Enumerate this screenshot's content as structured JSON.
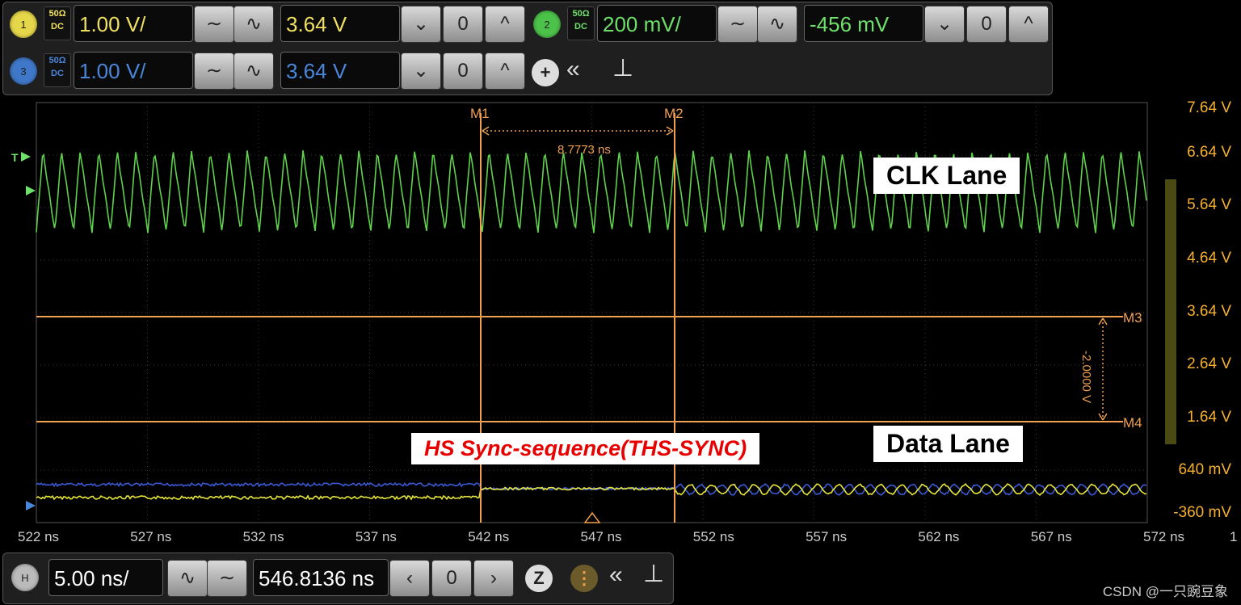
{
  "channels": [
    {
      "id": "1",
      "color": "#e6d64a",
      "impedance": "50Ω",
      "coupling": "DC",
      "scale": "1.00 V/",
      "offset": "3.64 V",
      "text_color": "#f0e060"
    },
    {
      "id": "2",
      "color": "#4cc24a",
      "impedance": "50Ω",
      "coupling": "DC",
      "scale": "200 mV/",
      "offset": "-456 mV",
      "text_color": "#6fe06a"
    },
    {
      "id": "3",
      "color": "#3f78c8",
      "impedance": "50Ω",
      "coupling": "DC",
      "scale": "1.00 V/",
      "offset": "3.64 V",
      "text_color": "#4a86d9"
    }
  ],
  "controls": {
    "down": "⌄",
    "zero": "0",
    "up": "^",
    "add": "+",
    "collapse": "«",
    "pin": "⊥"
  },
  "markers": {
    "m1": "M1",
    "m2": "M2",
    "m3": "M3",
    "m4": "M4",
    "time_delta": "8.7773 ns",
    "volt_delta": "-2.0000 V"
  },
  "y_axis": [
    "7.64 V",
    "6.64 V",
    "5.64 V",
    "4.64 V",
    "3.64 V",
    "2.64 V",
    "1.64 V",
    "640 mV",
    "-360 mV"
  ],
  "x_axis": [
    "522 ns",
    "527 ns",
    "532 ns",
    "537 ns",
    "542 ns",
    "547 ns",
    "552 ns",
    "557 ns",
    "562 ns",
    "567 ns",
    "572 ns"
  ],
  "x_axis_extra": "1",
  "annotations": {
    "clk": "CLK Lane",
    "data": "Data Lane",
    "sync": "HS Sync-sequence(THS-SYNC)"
  },
  "horizontal": {
    "label": "H",
    "scale": "5.00 ns/",
    "position": "546.8136 ns"
  },
  "watermark": "CSDN @一只豌豆象",
  "colors": {
    "clk": "#5fd24c",
    "data_yellow": "#e6e63c",
    "data_blue": "#3c5ad6",
    "marker": "#f0a050",
    "grid": "#3a3a3a"
  }
}
